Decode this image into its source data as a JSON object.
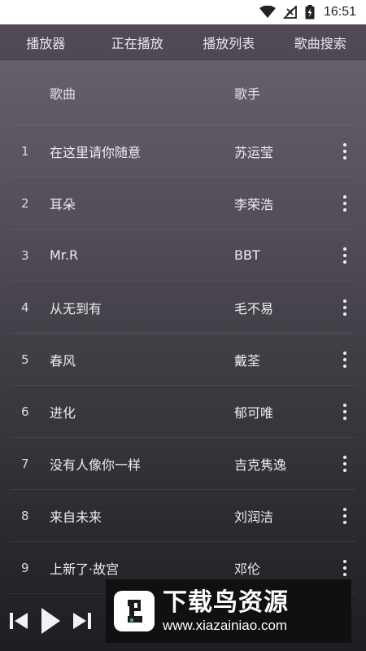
{
  "status_bar": {
    "time": "16:51"
  },
  "tabs": [
    {
      "label": "播放器"
    },
    {
      "label": "正在播放"
    },
    {
      "label": "播放列表"
    },
    {
      "label": "歌曲搜索"
    }
  ],
  "list_header": {
    "song": "歌曲",
    "artist": "歌手"
  },
  "songs": [
    {
      "num": "1",
      "title": "在这里请你随意",
      "artist": "苏运莹"
    },
    {
      "num": "2",
      "title": "耳朵",
      "artist": "李荣浩"
    },
    {
      "num": "3",
      "title": "Mr.R",
      "artist": "BBT"
    },
    {
      "num": "4",
      "title": "从无到有",
      "artist": "毛不易"
    },
    {
      "num": "5",
      "title": "春风",
      "artist": "戴荃"
    },
    {
      "num": "6",
      "title": "进化",
      "artist": "郁可唯"
    },
    {
      "num": "7",
      "title": "没有人像你一样",
      "artist": "吉克隽逸"
    },
    {
      "num": "8",
      "title": "来自未来",
      "artist": "刘润洁"
    },
    {
      "num": "9",
      "title": "上新了·故宫",
      "artist": "邓伦"
    }
  ],
  "watermark": {
    "title": "下载鸟资源",
    "url": "www.xiazainiao.com"
  },
  "icons": {
    "wifi": "wifi-icon",
    "signal": "signal-icon",
    "battery": "battery-icon",
    "more": "more-vertical-icon",
    "prev": "skip-previous-icon",
    "play": "play-icon",
    "next": "skip-next-icon",
    "logo": "bird-logo-icon"
  },
  "colors": {
    "logo_green": "#2fb35a",
    "watermark_bg": "#101010"
  }
}
